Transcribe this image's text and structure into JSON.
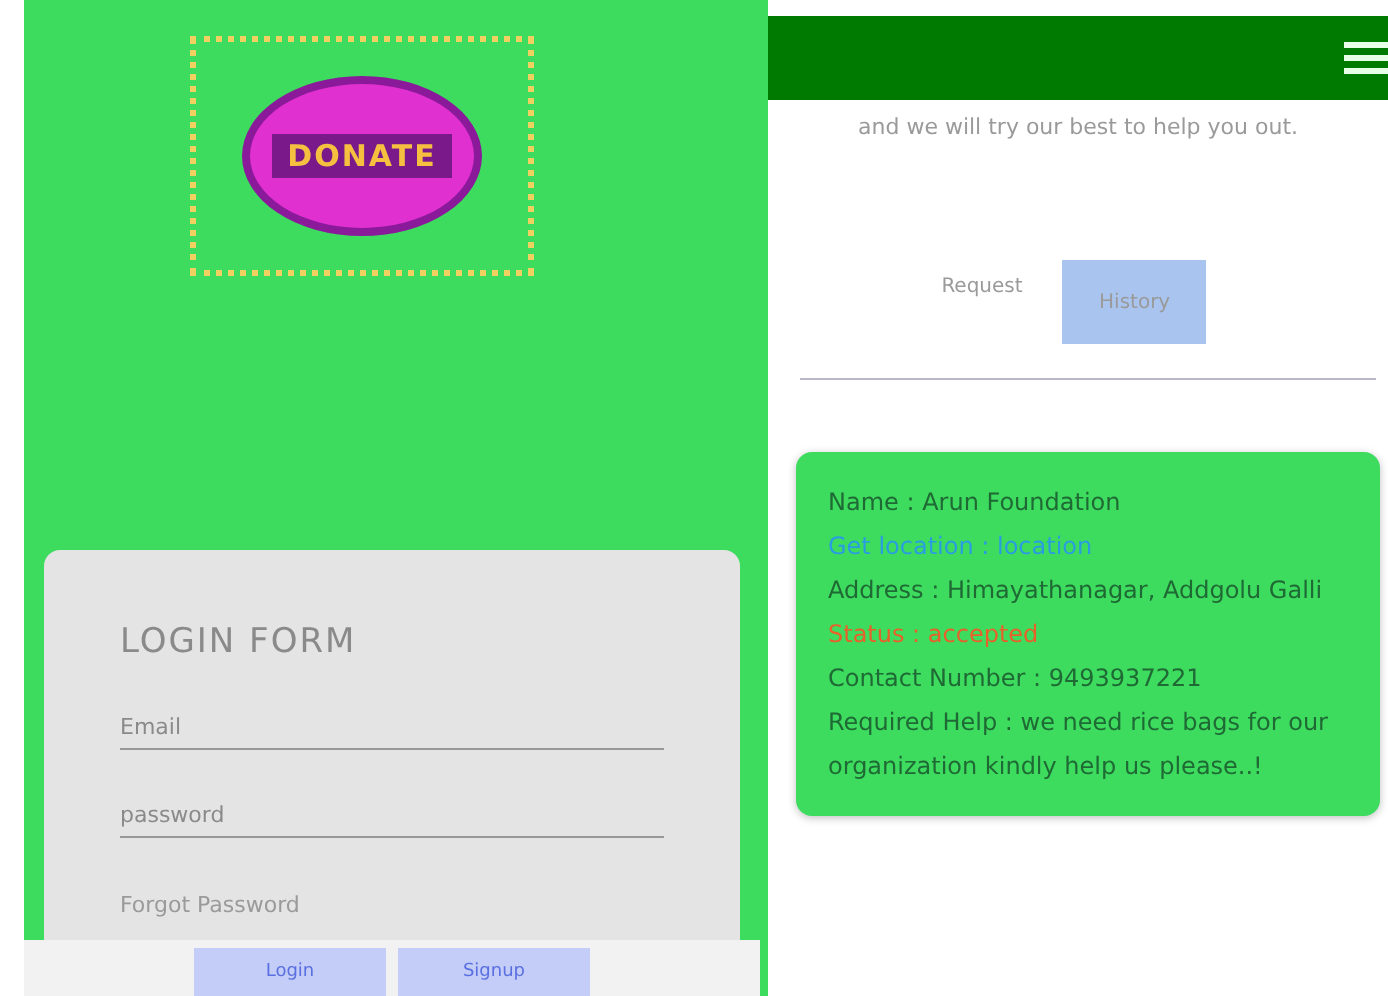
{
  "left": {
    "logo": {
      "text": "DONATE"
    },
    "login_form": {
      "title": "LOGIN FORM",
      "fields": [
        {
          "placeholder": "Email"
        },
        {
          "placeholder": "password"
        }
      ],
      "forgot_link": "Forgot Password",
      "buttons": [
        "Login",
        "Signup"
      ]
    }
  },
  "right": {
    "intro": "and we will try our best to help you out.",
    "tabs": [
      {
        "label": "Request",
        "selected": false
      },
      {
        "label": "History",
        "selected": true
      }
    ],
    "request_card": {
      "lines": [
        {
          "kind": "plain",
          "text": "Name : Arun Foundation"
        },
        {
          "kind": "link",
          "text": "Get location : location"
        },
        {
          "kind": "plain",
          "text": "Address : Himayathanagar, Addgolu Galli"
        },
        {
          "kind": "status",
          "text": "Status : accepted"
        },
        {
          "kind": "plain",
          "text": "Contact Number : 9493937221"
        },
        {
          "kind": "plain",
          "text": "Required Help : we need rice bags for our organization kindly help us please..!"
        }
      ]
    }
  }
}
